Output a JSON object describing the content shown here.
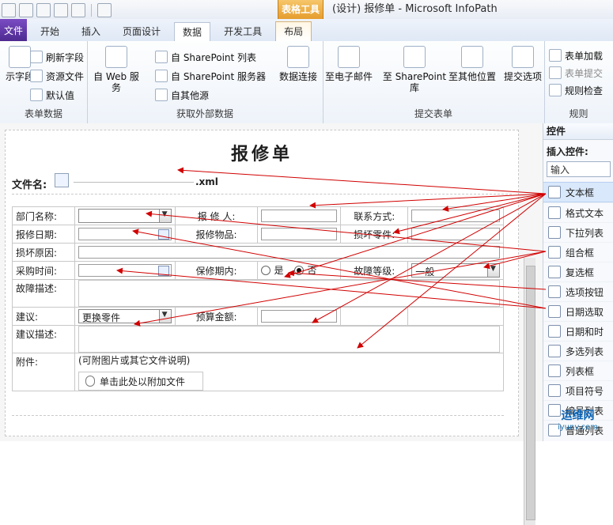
{
  "window": {
    "context_tab": "表格工具",
    "title": "(设计) 报修单 - Microsoft InfoPath"
  },
  "tabs": {
    "file": "文件",
    "items": [
      "开始",
      "插入",
      "页面设计",
      "数据",
      "开发工具",
      "布局"
    ],
    "active": "数据"
  },
  "ribbon": {
    "groups": [
      {
        "label": "表单数据",
        "buttons": [
          {
            "label": "示字段",
            "type": "big"
          },
          {
            "label": "刷新字段",
            "type": "small"
          },
          {
            "label": "资源文件",
            "type": "small"
          },
          {
            "label": "默认值",
            "type": "small"
          }
        ]
      },
      {
        "label": "获取外部数据",
        "buttons": [
          {
            "label": "自 Web 服务",
            "type": "big"
          },
          {
            "label": "自 SharePoint 列表",
            "type": "small"
          },
          {
            "label": "自  SharePoint 服务器",
            "type": "small"
          },
          {
            "label": "自其他源",
            "type": "small"
          },
          {
            "label": "数据连接",
            "type": "big"
          }
        ]
      },
      {
        "label": "提交表单",
        "buttons": [
          {
            "label": "至电子邮件",
            "type": "big"
          },
          {
            "label": "至 SharePoint 库",
            "type": "big"
          },
          {
            "label": "至其他位置",
            "type": "big"
          },
          {
            "label": "提交选项",
            "type": "big"
          }
        ]
      },
      {
        "label": "规则",
        "buttons": [
          {
            "label": "表单加载",
            "type": "small"
          },
          {
            "label": "表单提交",
            "type": "small",
            "disabled": true
          },
          {
            "label": "规则检查",
            "type": "small"
          }
        ]
      }
    ]
  },
  "form": {
    "title": "报修单",
    "filename_label": "文件名:",
    "xml": ".xml",
    "rows": {
      "dept_label": "部门名称:",
      "repair_person_label": "报 修 人:",
      "contact_label": "联系方式:",
      "repair_date_label": "报修日期:",
      "repair_item_label": "报修物品:",
      "broken_part_label": "损坏零件:",
      "broken_reason_label": "损坏原因:",
      "purchase_time_label": "采购时间:",
      "warranty_label": "保修期内:",
      "yes": "是",
      "no": "否",
      "fault_level_label": "故障等级:",
      "fault_level_value": "一般",
      "fault_desc_label": "故障描述:",
      "suggest_label": "建议:",
      "suggest_value": "更换零件",
      "budget_label": "预算金额:",
      "suggest_desc_label": "建议描述:",
      "attachment_label": "附件:",
      "attachment_note": "(可附图片或其它文件说明)",
      "attachment_action": "单击此处以附加文件"
    }
  },
  "pane": {
    "header": "控件",
    "insert_label": "插入控件:",
    "dropdown_value": "输入",
    "controls": [
      "文本框",
      "格式文本",
      "下拉列表",
      "组合框",
      "复选框",
      "选项按钮",
      "日期选取",
      "日期和时",
      "多选列表",
      "列表框",
      "项目符号",
      "编号列表",
      "普通列表"
    ]
  },
  "watermark": {
    "line1": "运维网",
    "line2": "iyunv.com"
  }
}
